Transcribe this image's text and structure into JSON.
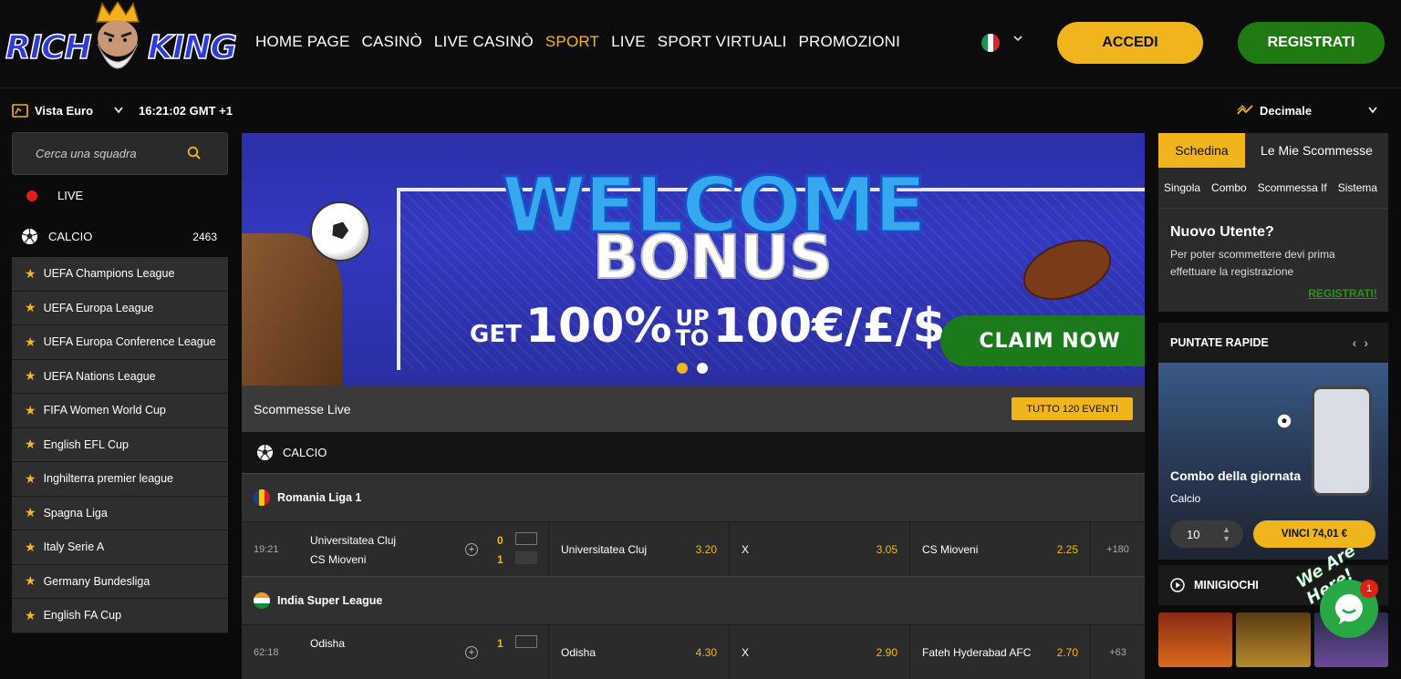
{
  "brand": {
    "logo_left": "RICH",
    "logo_right": "KING"
  },
  "nav": {
    "items": [
      {
        "label": "HOME PAGE"
      },
      {
        "label": "CASINÒ"
      },
      {
        "label": "LIVE CASINÒ"
      },
      {
        "label": "SPORT"
      },
      {
        "label": "LIVE"
      },
      {
        "label": "SPORT VIRTUALI"
      },
      {
        "label": "PROMOZIONI"
      }
    ],
    "active": "SPORT"
  },
  "auth": {
    "login": "ACCEDI",
    "register": "REGISTRATI"
  },
  "subbar": {
    "view": "Vista Euro",
    "clock": "16:21:02 GMT +1",
    "odds_format": "Decimale"
  },
  "sidebar": {
    "search_placeholder": "Cerca una squadra",
    "live_label": "LIVE",
    "football_label": "CALCIO",
    "football_count": "2463",
    "leagues": [
      "UEFA Champions League",
      "UEFA Europa League",
      "UEFA Europa Conference League",
      "UEFA Nations League",
      "FIFA Women World Cup",
      "English EFL Cup",
      "Inghilterra premier league",
      "Spagna Liga",
      "Italy Serie A",
      "Germany Bundesliga",
      "English FA Cup"
    ]
  },
  "banner": {
    "headline": "WELCOME",
    "headline2": "BONUS",
    "get": "GET",
    "pct": "100%",
    "up": "UP",
    "to": "TO",
    "amount": "100€/£/$",
    "cta": "CLAIM NOW",
    "active_slide": 1,
    "slides": 2
  },
  "live": {
    "title": "Scommesse Live",
    "all_events": "TUTTO 120 EVENTI",
    "sport": "CALCIO",
    "competitions": [
      {
        "name": "Romania Liga 1",
        "match": {
          "time": "19:21",
          "home": "Universitatea Cluj",
          "away": "CS Mioveni",
          "score_home": "0",
          "score_away": "1",
          "odds": [
            {
              "label": "Universitatea Cluj",
              "value": "3.20"
            },
            {
              "label": "X",
              "value": "3.05"
            },
            {
              "label": "CS Mioveni",
              "value": "2.25"
            }
          ],
          "more": "+180"
        }
      },
      {
        "name": "India Super League",
        "match": {
          "time": "62:18",
          "home": "Odisha",
          "away": "",
          "score_home": "1",
          "score_away": "",
          "odds": [
            {
              "label": "Odisha",
              "value": "4.30"
            },
            {
              "label": "X",
              "value": "2.90"
            },
            {
              "label": "Fateh Hyderabad AFC",
              "value": "2.70"
            }
          ],
          "more": "+63"
        }
      }
    ]
  },
  "betslip": {
    "tab_active": "Schedina",
    "tab_other": "Le Mie Scommesse",
    "types": [
      "Singola",
      "Combo",
      "Scommessa If",
      "Sistema"
    ],
    "title": "Nuovo Utente?",
    "text": "Per poter scommettere devi prima effettuare la registrazione",
    "link": "REGISTRATI!"
  },
  "quick_bets": {
    "title": "PUNTATE RAPIDE",
    "card_title": "Combo della giornata",
    "card_sub": "Calcio",
    "stake": "10",
    "win": "VINCI 74,01 €"
  },
  "minigames": {
    "title": "MINIGIOCHI"
  },
  "chat": {
    "badge": "1",
    "tagline": "We Are Here!"
  },
  "colors": {
    "accent": "#f0b51d",
    "register": "#1f7a12",
    "background": "#0b0b0b"
  }
}
